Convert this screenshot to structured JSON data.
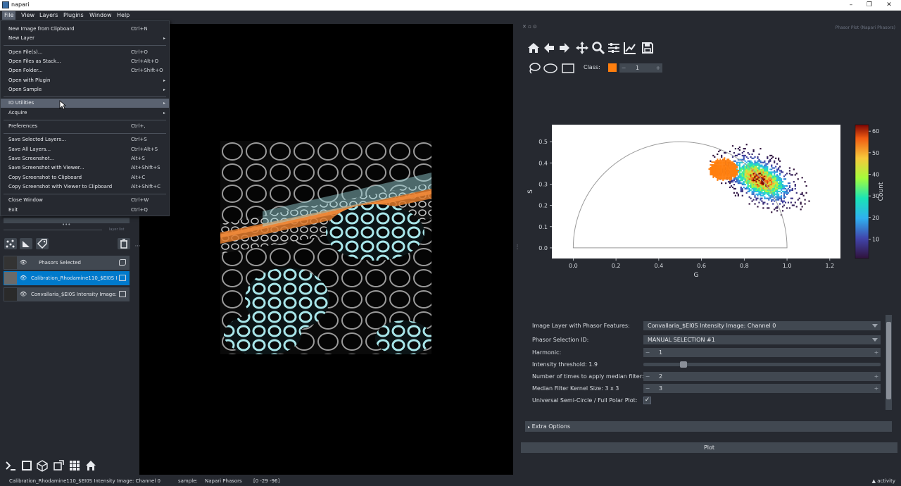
{
  "window": {
    "title": "napari",
    "minimize": "–",
    "restore": "❐",
    "close": "✕"
  },
  "menubar": [
    "File",
    "View",
    "Layers",
    "Plugins",
    "Window",
    "Help"
  ],
  "file_menu": {
    "items": [
      {
        "label": "New Image from Clipboard",
        "shortcut": "Ctrl+N"
      },
      {
        "label": "New Layer",
        "shortcut": "",
        "submenu": true
      },
      {
        "label": "Open File(s)...",
        "shortcut": "Ctrl+O"
      },
      {
        "label": "Open Files as Stack...",
        "shortcut": "Ctrl+Alt+O"
      },
      {
        "label": "Open Folder...",
        "shortcut": "Ctrl+Shift+O"
      },
      {
        "label": "Open with Plugin",
        "shortcut": "",
        "submenu": true
      },
      {
        "label": "Open Sample",
        "shortcut": "",
        "submenu": true
      },
      {
        "label": "IO Utilities",
        "shortcut": "",
        "submenu": true,
        "highlighted": true
      },
      {
        "label": "Acquire",
        "shortcut": "",
        "submenu": true
      },
      {
        "label": "Preferences",
        "shortcut": "Ctrl+,"
      },
      {
        "label": "Save Selected Layers...",
        "shortcut": "Ctrl+S"
      },
      {
        "label": "Save All Layers...",
        "shortcut": "Ctrl+Alt+S"
      },
      {
        "label": "Save Screenshot...",
        "shortcut": "Alt+S"
      },
      {
        "label": "Save Screenshot with Viewer...",
        "shortcut": "Alt+Shift+S"
      },
      {
        "label": "Copy Screenshot to Clipboard",
        "shortcut": "Alt+C"
      },
      {
        "label": "Copy Screenshot with Viewer to Clipboard",
        "shortcut": "Alt+Shift+C"
      },
      {
        "label": "Close Window",
        "shortcut": "Ctrl+W"
      },
      {
        "label": "Exit",
        "shortcut": "Ctrl+Q"
      }
    ]
  },
  "left_panel": {
    "dock_handle": "•••",
    "layer_list_title": "layer list",
    "layers": [
      {
        "name": "Phasors Selected",
        "type": "labels",
        "visible": true,
        "selected": false
      },
      {
        "name": "Calibration_Rhodamine110_$EI0S Intensity Image: Channel 0",
        "type": "image",
        "visible": true,
        "selected": true
      },
      {
        "name": "Convallaria_$EI0S Intensity Image: Channel 0",
        "type": "image",
        "visible": true,
        "selected": false
      }
    ]
  },
  "phasor_dock": {
    "title": "Phasor Plot (Napari Phasors)",
    "toolbar_icons": [
      "home-icon",
      "back-arrow-icon",
      "forward-arrow-icon",
      "pan-icon",
      "zoom-icon",
      "configure-icon",
      "line-edit-icon",
      "save-icon"
    ],
    "selection_tools": [
      "lasso-icon",
      "ellipse-icon",
      "rectangle-icon"
    ],
    "class_label": "Class:",
    "class_value": "1",
    "class_color": "#ff7f0e",
    "form": {
      "image_layer_label": "Image Layer with Phasor Features:",
      "image_layer_value": "Convallaria_$EI0S Intensity Image: Channel 0",
      "selection_id_label": "Phasor Selection ID:",
      "selection_id_value": "MANUAL SELECTION #1",
      "harmonic_label": "Harmonic:",
      "harmonic_value": "1",
      "intensity_label": "Intensity threshold: 1.9",
      "intensity_fraction": 0.17,
      "median_times_label": "Number of times to apply median filter:",
      "median_times_value": "2",
      "kernel_label": "Median Filter Kernel Size: 3 x 3",
      "kernel_value": "3",
      "semicircle_label": "Universal Semi-Circle / Full Polar Plot:",
      "semicircle_checked": true,
      "extra_options": "Extra Options",
      "plot_button": "Plot"
    }
  },
  "chart_data": {
    "type": "heatmap",
    "xlabel": "G",
    "ylabel": "S",
    "xlim": [
      -0.1,
      1.25
    ],
    "ylim": [
      -0.05,
      0.58
    ],
    "xticks": [
      "0.0",
      "0.2",
      "0.4",
      "0.6",
      "0.8",
      "1.0",
      "1.2"
    ],
    "yticks": [
      "0.0",
      "0.1",
      "0.2",
      "0.3",
      "0.4",
      "0.5"
    ],
    "colorbar_label": "Count",
    "colorbar_ticks": [
      "10",
      "20",
      "30",
      "40",
      "50",
      "60"
    ],
    "colorbar_range": [
      1,
      63
    ],
    "semicircle": {
      "center": [
        0.5,
        0.0
      ],
      "radius": 0.5
    },
    "clusters": [
      {
        "name": "density",
        "center": [
          0.87,
          0.32
        ],
        "sx": 0.085,
        "sy": 0.045,
        "angle_deg": -28,
        "peak": 63
      },
      {
        "name": "selection",
        "center": [
          0.7,
          0.365
        ],
        "sx": 0.04,
        "sy": 0.03,
        "color": "#ff7f0e"
      }
    ]
  },
  "status": {
    "layer": "Calibration_Rhodamine110_$EI0S Intensity Image: Channel 0",
    "sample_label": "sample:",
    "sample_value": "Napari Phasors",
    "coords": "[0 -29 -96]",
    "activity": "activity"
  }
}
